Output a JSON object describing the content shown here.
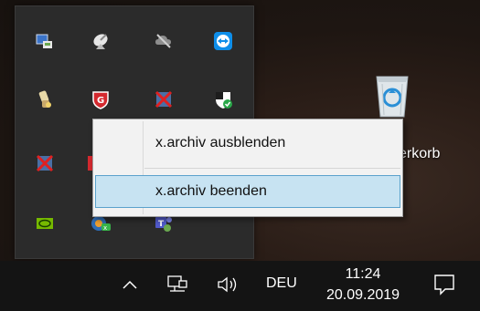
{
  "context_menu": {
    "items": [
      {
        "label": "x.archiv ausblenden"
      },
      {
        "label": "x.archiv beenden"
      }
    ]
  },
  "desktop": {
    "recycle_bin_label": "erkorb"
  },
  "taskbar": {
    "language": "DEU",
    "time": "11:24",
    "date": "20.09.2019"
  },
  "tray_icons": [
    "network-drive-icon",
    "satellite-dish-icon",
    "cloud-sync-disabled-icon",
    "teamviewer-icon",
    "usb-device-icon",
    "gdata-shield-icon",
    "disabled-app-icon",
    "windows-security-icon",
    "disabled-app-icon-2",
    "red-app-icon",
    "nvidia-icon",
    "xarchiv-icon",
    "teams-icon"
  ],
  "colors": {
    "tray_background": "#2b2b2b",
    "taskbar": "#141414",
    "menu_background": "#f2f2f2",
    "menu_hover": "#c7e3f2",
    "menu_hover_border": "#5ba2cc"
  }
}
